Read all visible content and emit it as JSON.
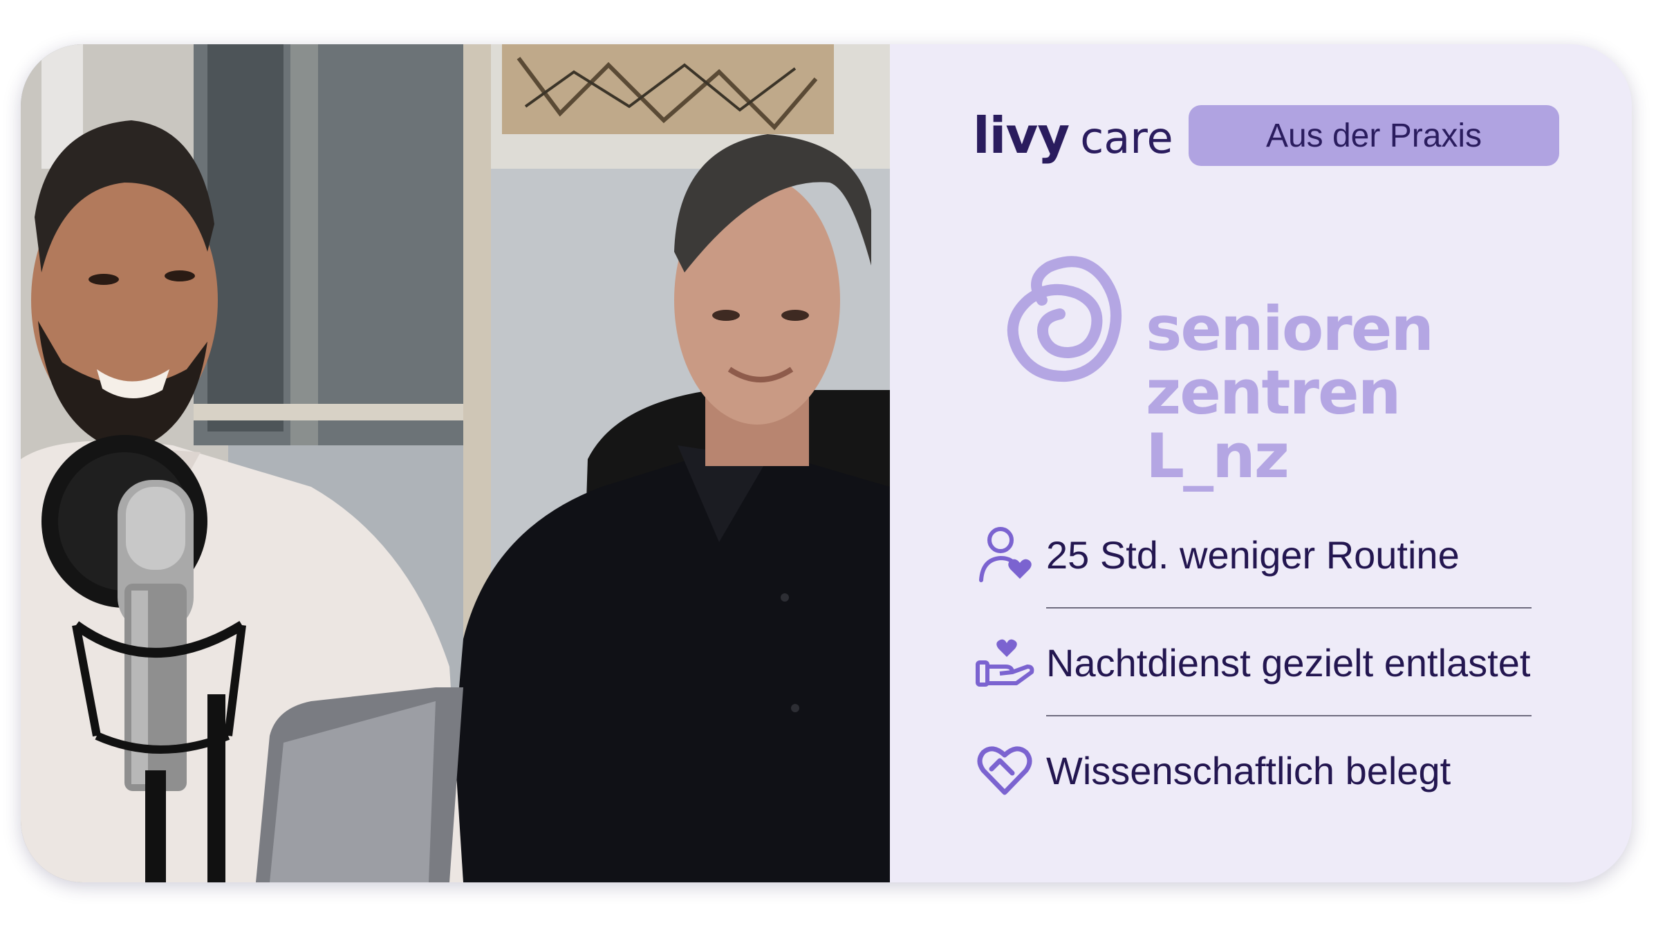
{
  "brand": {
    "name_bold": "livy",
    "name_light": "care"
  },
  "badge": {
    "label": "Aus der Praxis"
  },
  "partner": {
    "line1": "senioren",
    "line2": "zentren L_nz"
  },
  "features": [
    {
      "icon": "person-heart-icon",
      "label": "25 Std. weniger Routine"
    },
    {
      "icon": "hand-heart-icon",
      "label": "Nachtdienst gezielt entlastet"
    },
    {
      "icon": "heart-outline-icon",
      "label": "Wissenschaftlich belegt"
    }
  ],
  "colors": {
    "panel_background": "#eeebf8",
    "badge_background": "#b0a3e1",
    "accent": "#b4a6e3",
    "text_dark": "#231650",
    "icon": "#7b63d0"
  }
}
